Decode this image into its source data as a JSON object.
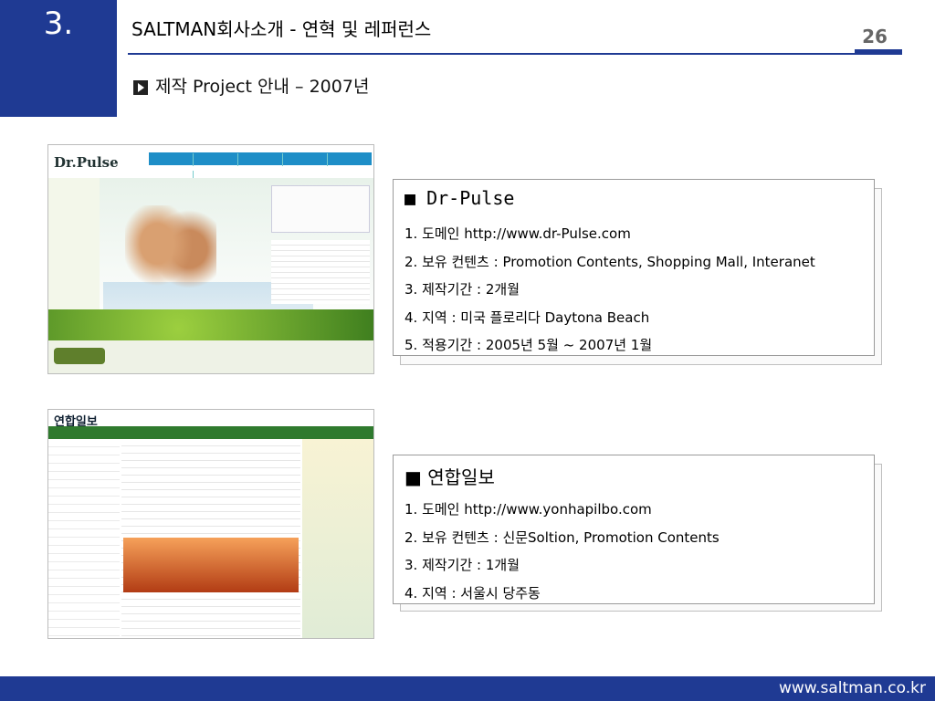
{
  "section": {
    "number": "3."
  },
  "header": {
    "title": "SALTMAN회사소개 - 연혁 및 레퍼런스",
    "page_number": "26"
  },
  "subtitle": "제작 Project 안내 – 2007년",
  "projects": [
    {
      "heading": "■ Dr-Pulse",
      "items": [
        "1. 도메인 http://www.dr-Pulse.com",
        "2. 보유 컨텐츠 : Promotion Contents, Shopping Mall, Interanet",
        "3. 제작기간 : 2개월",
        "4. 지역 : 미국 플로리다 Daytona Beach",
        "5. 적용기간 : 2005년 5월 ~ 2007년 1월"
      ]
    },
    {
      "heading": "■ 연합일보",
      "items": [
        "1. 도메인 http://www.yonhapilbo.com",
        "2. 보유 컨텐츠 : 신문Soltion, Promotion Contents",
        "3. 제작기간 : 1개월",
        "4. 지역 : 서울시 당주동"
      ]
    }
  ],
  "thumbnails": {
    "dr_pulse_logo": "Dr.Pulse",
    "yonhap_logo": "연합일보"
  },
  "footer": {
    "url": "www.saltman.co.kr"
  },
  "colors": {
    "accent": "#1f3a93"
  }
}
